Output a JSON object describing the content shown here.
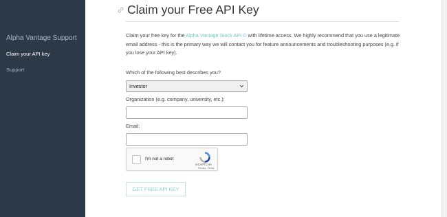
{
  "sidebar": {
    "title": "Alpha Vantage Support",
    "items": [
      {
        "label": "Claim your API key",
        "active": true
      },
      {
        "label": "Support",
        "active": false
      }
    ]
  },
  "main": {
    "title": "Claim your Free API Key",
    "intro": {
      "before_link": "Claim your free key for the ",
      "link_text": "Alpha Vantage Stock API ©",
      "after_link": " with lifetime access. We highly recommend that you use a legitimate email address - this is the primary way we will contact you for feature announcements and troubleshooting purposes (e.g. if you lose your API key)."
    },
    "form": {
      "role_question": "Which of the following best describes you?",
      "role_selected": "Investor",
      "organization_label": "Organization (e.g. company, university, etc.):",
      "organization_value": "",
      "email_label": "Email:",
      "email_value": ""
    },
    "captcha": {
      "label": "I'm not a robot",
      "brand": "reCAPTCHA",
      "privacy": "Privacy",
      "terms": "Terms"
    },
    "submit_label": "GET FREE API KEY"
  },
  "colors": {
    "sidebar_bg": "#2c3a47",
    "accent": "#6fc6c2"
  }
}
